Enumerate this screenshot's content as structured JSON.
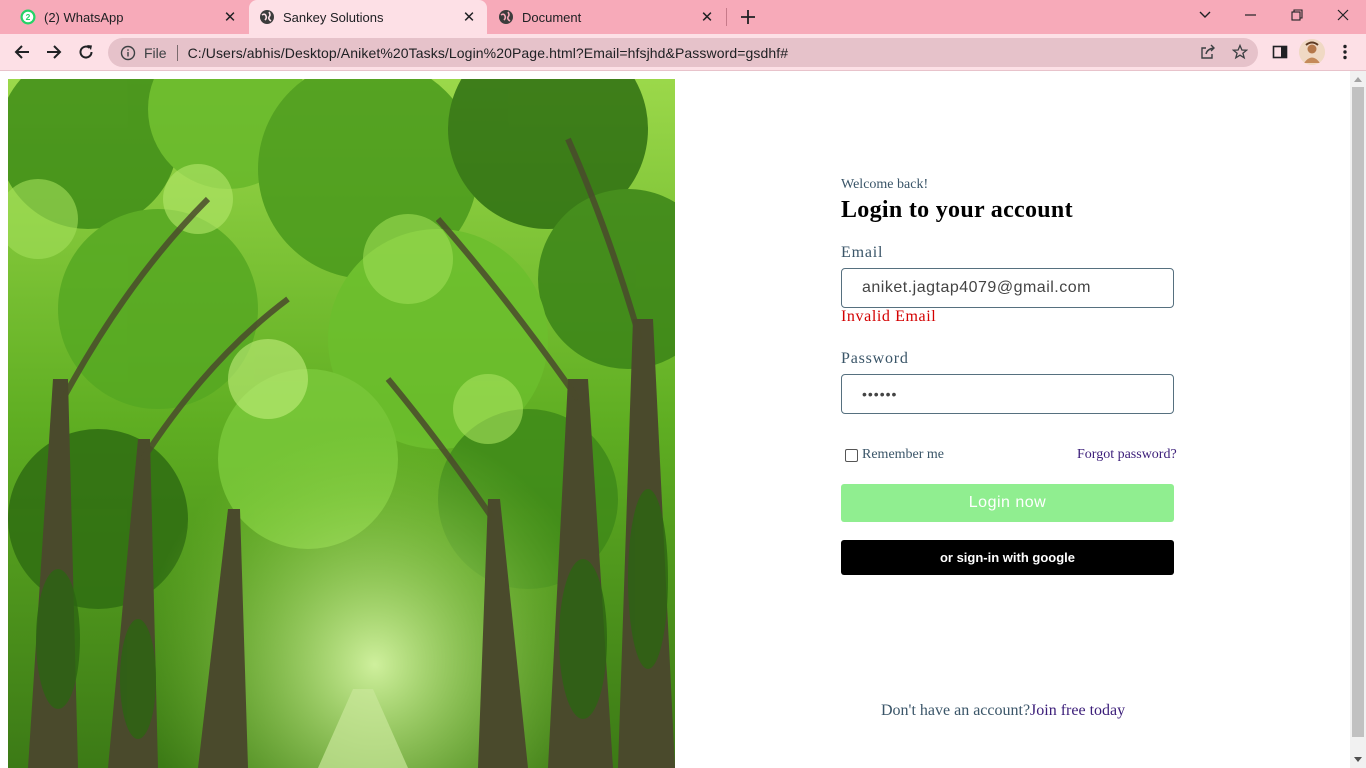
{
  "browser": {
    "tabs": [
      {
        "title": "(2) WhatsApp",
        "active": false,
        "icon": "whatsapp-icon",
        "badge": "2"
      },
      {
        "title": "Sankey Solutions",
        "active": true,
        "icon": "globe-icon"
      },
      {
        "title": "Document",
        "active": false,
        "icon": "globe-icon"
      }
    ],
    "address": {
      "scheme_label": "File",
      "url": "C:/Users/abhis/Desktop/Aniket%20Tasks/Login%20Page.html?Email=hfsjhd&Password=gsdhf#"
    },
    "colors": {
      "tabstrip": "#f7aab9",
      "toolbar": "#fde0e6",
      "omnibox": "#e6c2ca"
    }
  },
  "page": {
    "hero_image": "forest-canopy",
    "welcome": "Welcome back!",
    "heading": "Login to your account",
    "email": {
      "label": "Email",
      "value": "aniket.jagtap4079@gmail.com",
      "error": "Invalid Email"
    },
    "password": {
      "label": "Password",
      "value": "••••••"
    },
    "remember_label": "Remember me",
    "remember_checked": false,
    "forgot_label": "Forgot password?",
    "login_label": "Login now",
    "google_label": "or sign-in with google",
    "signup_prompt": "Don't have an account?",
    "signup_link": "Join free today",
    "colors": {
      "login_button": "#90ee90",
      "google_button": "#000000",
      "error": "#d30000",
      "link": "#3b1d79"
    }
  }
}
